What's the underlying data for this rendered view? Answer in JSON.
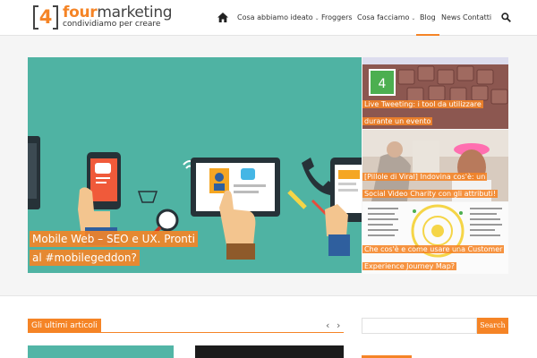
{
  "brand": {
    "number": "4",
    "word_bold": "four",
    "word_rest": "marketing",
    "tagline": "condividiamo per creare"
  },
  "nav": {
    "items": [
      {
        "label": "Cosa abbiamo ideato",
        "has_dropdown": true
      },
      {
        "label": "Froggers",
        "has_dropdown": false
      },
      {
        "label": "Cosa facciamo",
        "has_dropdown": true
      },
      {
        "label": "Blog",
        "has_dropdown": false,
        "active": true
      },
      {
        "label": "News",
        "has_dropdown": false
      },
      {
        "label": "Contatti",
        "has_dropdown": false
      }
    ],
    "icons": [
      "home-icon",
      "search-icon"
    ]
  },
  "featured": {
    "main": {
      "caption_line1": "Mobile Web – SEO e UX. Pronti",
      "caption_line2": "al #mobilegeddon?"
    },
    "side": [
      {
        "caption": "Live Tweeting: i tool da utilizzare durante un evento"
      },
      {
        "caption": "[Pillole di Viral] Indovina cos'è: un Social Video Charity con gli attributi!"
      },
      {
        "caption": "Che cos'è e come usare una Customer Experience Journey Map?"
      }
    ]
  },
  "latest": {
    "title": "Gli ultimi articoli",
    "prev_label": "‹",
    "next_label": "›"
  },
  "search": {
    "placeholder": "",
    "button_label": "Search"
  },
  "colors": {
    "accent": "#f58426",
    "hero_bg": "#4fb3a3",
    "text": "#333333"
  }
}
